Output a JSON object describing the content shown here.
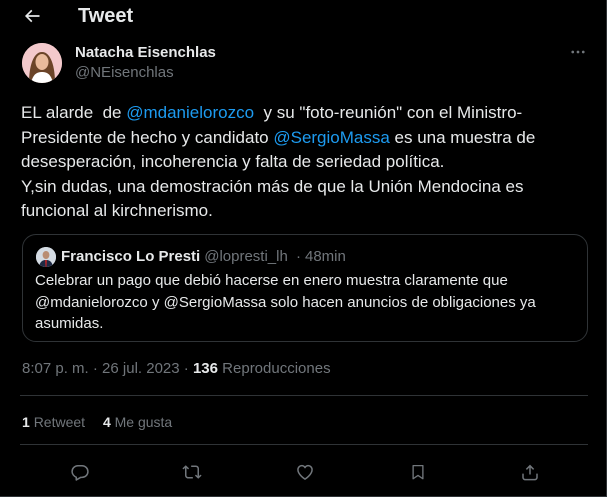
{
  "header": {
    "back_icon": "arrow-left-icon",
    "title": "Tweet"
  },
  "tweet": {
    "author": {
      "name": "Natacha Eisenchlas",
      "handle": "@NEisenchlas",
      "avatar_icon": "profile-photo"
    },
    "more_icon": "more-horizontal-icon",
    "text_parts": {
      "p1": "EL alarde  de ",
      "m1": "@mdanielorozco",
      "p2": "  y su \"foto-reunión\" con el Ministro-Presidente de hecho y candidato ",
      "m2": "@SergioMassa",
      "p3": " es una muestra de desesperación, incoherencia y falta de seriedad política.\nY,sin dudas, una demostración más de que la Unión Mendocina es funcional al kirchnerismo."
    },
    "quoted": {
      "name": "Francisco Lo Presti",
      "handle": "@lopresti_lh",
      "separator": "·",
      "time": "48min",
      "text": "Celebrar un pago que debió hacerse en enero muestra claramente que @mdanielorozco y @SergioMassa solo hacen anuncios de obligaciones ya asumidas."
    },
    "meta": {
      "time": "8:07 p. m.",
      "separator1": "·",
      "date": "26 jul. 2023",
      "separator2": "·",
      "views_count": "136",
      "views_label": "Reproducciones"
    },
    "stats": {
      "retweets_count": "1",
      "retweets_label": "Retweet",
      "likes_count": "4",
      "likes_label": "Me gusta"
    },
    "actions": {
      "reply_icon": "reply-icon",
      "retweet_icon": "retweet-icon",
      "like_icon": "heart-icon",
      "bookmark_icon": "bookmark-icon",
      "share_icon": "share-icon"
    }
  },
  "colors": {
    "background": "#000000",
    "text": "#e7e9ea",
    "secondary": "#71767b",
    "accent": "#1d9bf0",
    "border": "#2f3336"
  }
}
